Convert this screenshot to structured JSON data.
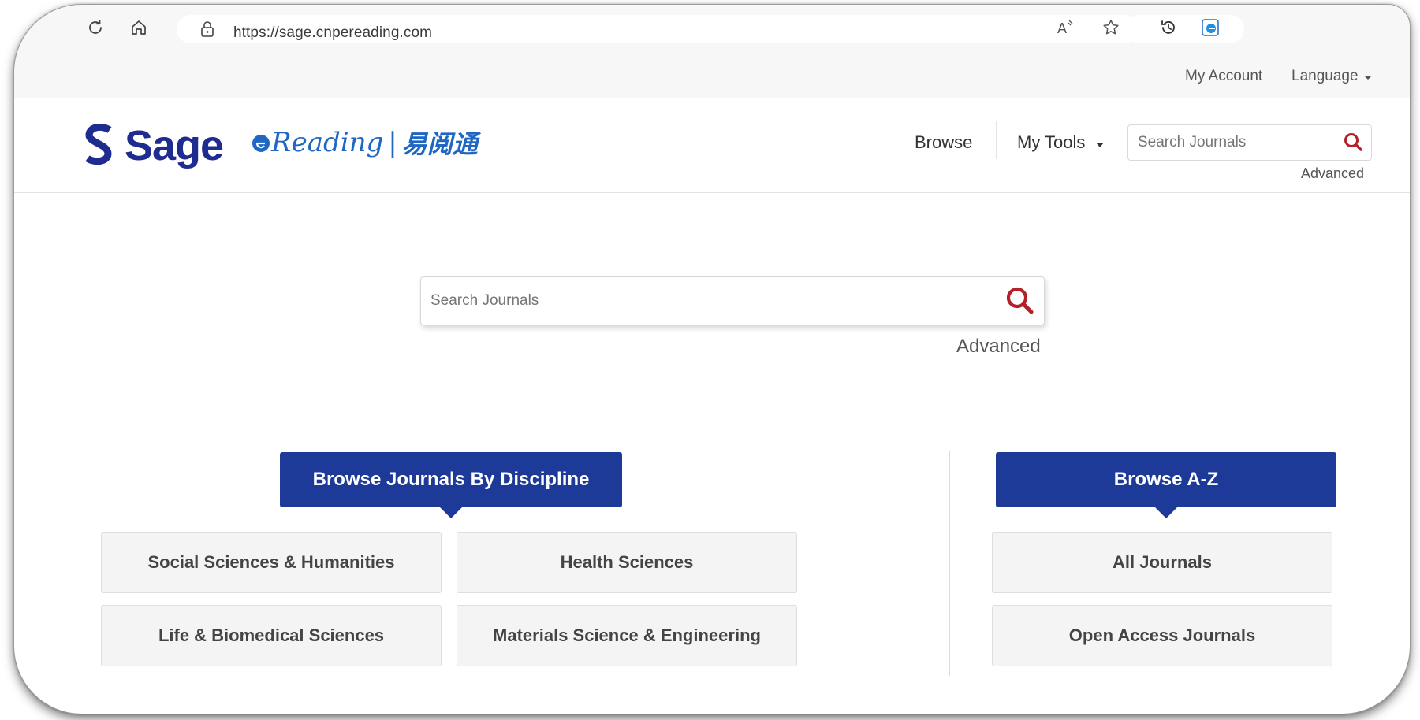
{
  "browser": {
    "url": "https://sage.cnpereading.com"
  },
  "utility": {
    "my_account": "My Account",
    "language": "Language"
  },
  "header": {
    "logo_sage": "Sage",
    "logo_ereading_latin": "Reading",
    "logo_ereading_cn": "易阅通",
    "nav_browse": "Browse",
    "nav_my_tools": "My Tools",
    "search_placeholder": "Search Journals",
    "advanced": "Advanced"
  },
  "main_search": {
    "placeholder": "Search Journals",
    "advanced": "Advanced"
  },
  "discipline": {
    "heading": "Browse Journals By Discipline",
    "items": [
      "Social Sciences & Humanities",
      "Health Sciences",
      "Life & Biomedical Sciences",
      "Materials Science & Engineering"
    ]
  },
  "az": {
    "heading": "Browse A-Z",
    "items": [
      "All Journals",
      "Open Access Journals"
    ]
  },
  "colors": {
    "brand_blue": "#1e3a99",
    "sage_logo": "#1e2c8f",
    "search_icon_red": "#b3202a"
  },
  "icons": [
    "reload-icon",
    "home-icon",
    "lock-icon",
    "read-aloud-icon",
    "favorite-star-icon",
    "history-icon",
    "edge-icon",
    "search-icon",
    "caret-down-icon"
  ]
}
